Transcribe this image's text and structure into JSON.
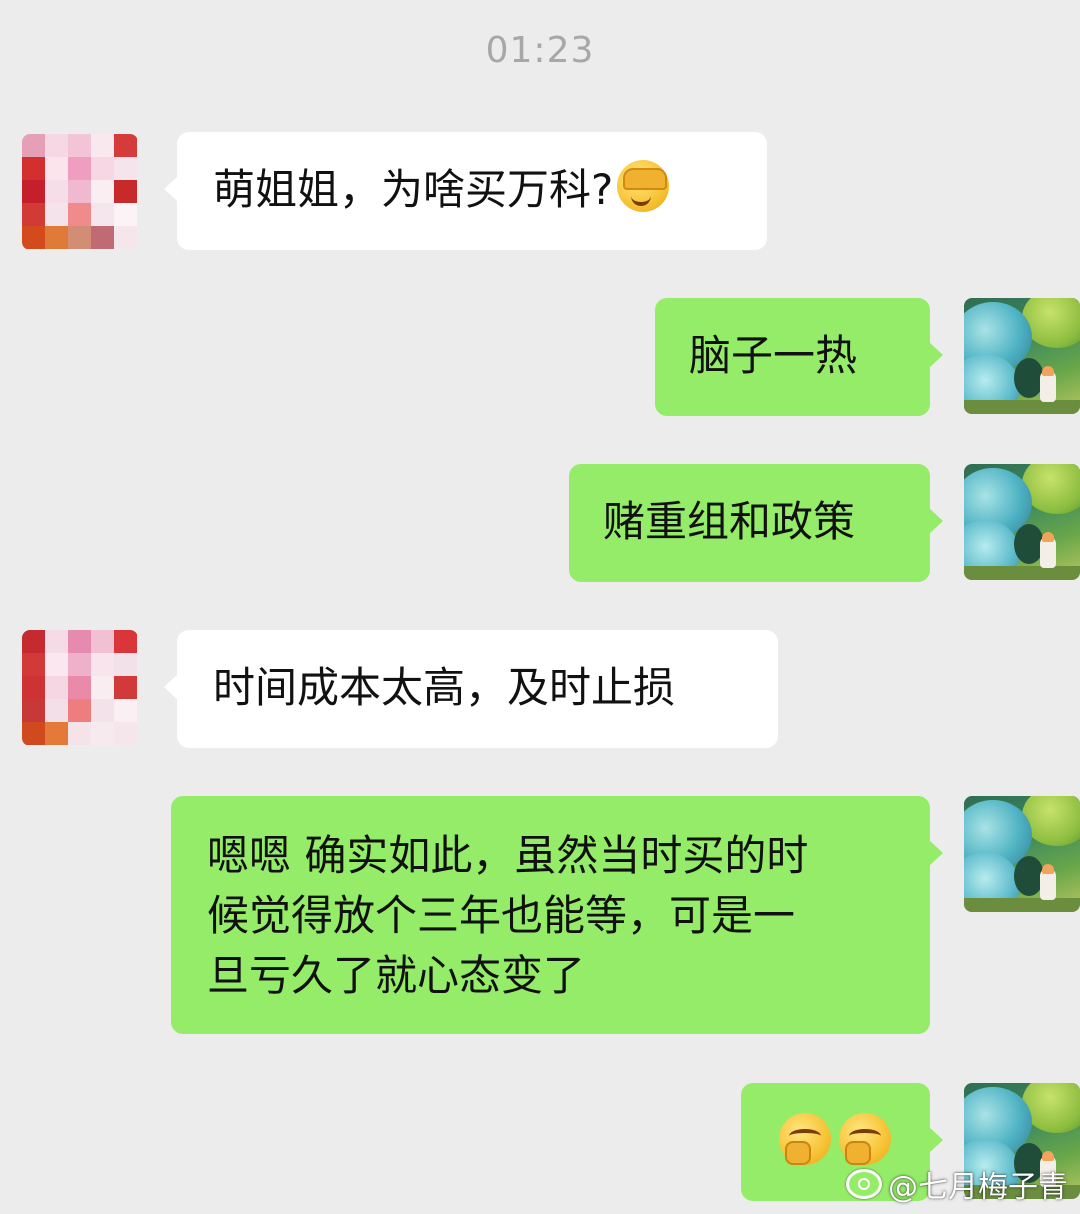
{
  "chat": {
    "timestamp": "01:23",
    "messages": [
      {
        "side": "in",
        "text": "萌姐姐，为啥买万科?",
        "emoji": "facepalm-crying-emoji"
      },
      {
        "side": "out",
        "text": "脑子一热"
      },
      {
        "side": "out",
        "text": "赌重组和政策"
      },
      {
        "side": "in",
        "text": "时间成本太高，及时止损"
      },
      {
        "side": "out",
        "lines": [
          "嗯嗯 确实如此，虽然当时买的时",
          "候觉得放个三年也能等，可是一",
          "旦亏久了就心态变了"
        ]
      },
      {
        "side": "out",
        "emojis": [
          "smirk-hand-over-mouth-emoji",
          "smirk-hand-over-mouth-emoji"
        ]
      }
    ]
  },
  "watermark": {
    "text": "@七月梅子青"
  },
  "colors": {
    "background": "#ececec",
    "incoming_bubble": "#ffffff",
    "outgoing_bubble": "#95ec69",
    "timestamp": "#a7a7a7"
  }
}
